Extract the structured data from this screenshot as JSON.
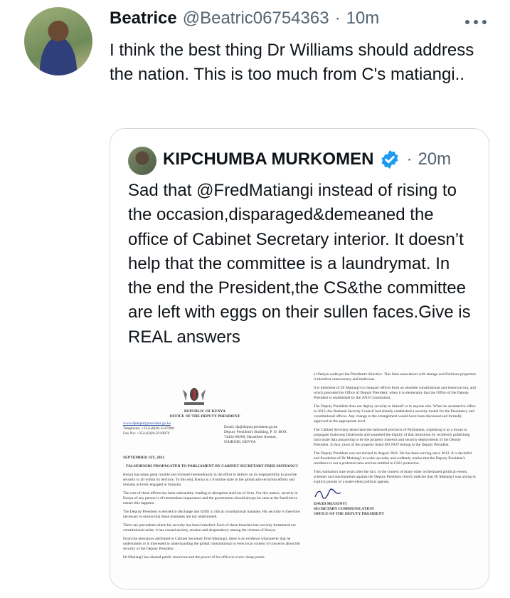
{
  "tweet": {
    "display_name": "Beatrice",
    "handle": "@Beatric06754363",
    "separator": "·",
    "time": "10m",
    "text": "I think the best thing Dr Williams should address the nation. This is too much from C's matiangi.."
  },
  "quoted_tweet": {
    "display_name": "KIPCHUMBA MURKOMEN",
    "separator": "·",
    "time": "20m",
    "text": "Sad that @FredMatiangi instead of rising to the occasion,disparaged&demeaned the office of Cabinet Secretary interior. It doesn’t help that the committee is a laundrymat. In the end the President,the CS&the committee are left with eggs on their sullen faces.Give is REAL answers"
  },
  "document": {
    "republic": "REPUBLIC OF KENYA",
    "office": "OFFICE OF THE DEPUTY PRESIDENT",
    "website": "www.dpdeputypresident.go.ke",
    "telephone": "Telephone: +254-(0)20-3247000",
    "fax": "Fax No: +254-(0)20-2210874",
    "email": "Email: dp@deputypresident.go.ke",
    "address": "Deputy President's Building, P. O. BOX 74434-00200, Harambee Avenue, NAIROBI, KENYA.",
    "date": "SEPTEMBER 1ST, 2021",
    "heading": "FALSEHOODS PROPAGATED TO PARLIAMENT BY CABINET SECRETARY FRED MATIANG'I",
    "left_paragraphs": [
      "Kenya has taken great trouble and invested tremendously in the effort to deliver on its responsibility to provide security to all within its territory. To this end, Kenya is a frontline state in the global anti-terrorism efforts and remains actively engaged in Somalia.",
      "The cost of these efforts has been unbearable, leading to disruption and loss of lives. For this reason, security in Kenya of any person is of tremendous importance and the government should always be seen at the forefront to ensure this happens.",
      "The Deputy President is elected to discharge and fulfill a critical constitutional mandate. His security is therefore necessary to ensure that these mandates are not undermined.",
      "There are precedents where his security has been breached. Each of these breaches has not only threatened our constitutional order; it has caused anxiety, tension and despondency among the citizens of Kenya.",
      "From the utterances attributed to Cabinet Secretary Fred Matiang'i, there is no evidence whatsoever that he understands or is interested in understanding the global constitutional or even local context of concerns about the security of the Deputy President.",
      "Dr Matiang'i has abused public resources and the power of his office to score cheap points"
    ],
    "right_paragraphs": [
      "a lifestyle audit per the President's directive. This false association with strange and fictitious properties is therefore unnecessary and malicious.",
      "It is dishonest of Dr Matiang'i to compare offices from an obsolete constitutional and historical era, and which preceded the Office of Deputy President, when it is elementary that the Office of the Deputy President is established by the 2010 Constitution.",
      "The Deputy President does not deploy security to himself or to anyone else. When he assumed to office in 2013, the National Security Council had already established a security model for the Presidency and constitutional offices. Any change to the arrangement would have been discussed and formally approved at the appropriate level.",
      "The Cabinet Secretary desecrated the hallowed precincts of Parliament, exploiting it as a forum to propagate malicious falsehoods and assaulted the dignity of that institution by recklessly publishing inaccurate data purporting to be the property interests and security deployments of the Deputy President. In fact, most of the property listed DO NOT belong to the Deputy President.",
      "The Deputy President was not elected in August 2021. He has been serving since 2013. It is deceitful and fraudulent of Dr Matiang'i to wake up today and suddenly realise that the Deputy President's residence is not a protected area and not entitled to GSU protection.",
      "This realisation nine years after the fact, in the context of many other orchestrated political events, schemes and machinations against the Deputy President clearly indicate that Dr Matiang'i was acting in explicit pursuit of a malevolent political agenda."
    ],
    "signatory_name": "DAVID MUGONYI",
    "signatory_title": "SECRETARY COMMUNICATION",
    "signatory_office": "OFFICE OF THE DEPUTY PRESIDENT"
  },
  "icons": {
    "more": "more-options-icon",
    "verified": "verified-badge-icon",
    "coat_of_arms": "coat-of-arms-icon"
  },
  "colors": {
    "text": "#0f1419",
    "muted": "#536471",
    "verified": "#1d9bf0",
    "border": "#cfd9de"
  }
}
